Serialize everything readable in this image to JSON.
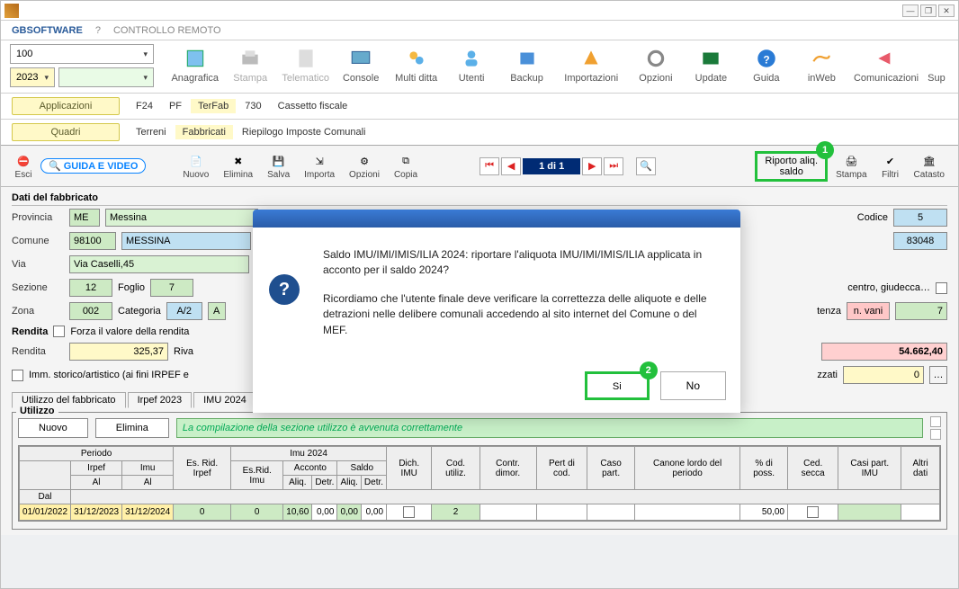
{
  "window": {
    "minimize": "—",
    "restore": "❐",
    "close": "✕"
  },
  "menu": {
    "main": "GBSOFTWARE",
    "help": "?",
    "remote": "CONTROLLO REMOTO"
  },
  "combos": {
    "num": "100",
    "year": "2023"
  },
  "ribbon": {
    "anagrafica": "Anagrafica",
    "stampa": "Stampa",
    "telematico": "Telematico",
    "console": "Console",
    "multiditta": "Multi ditta",
    "utenti": "Utenti",
    "backup": "Backup",
    "importazioni": "Importazioni",
    "opzioni": "Opzioni",
    "update": "Update",
    "guida": "Guida",
    "inweb": "inWeb",
    "comunicazioni": "Comunicazioni",
    "sup": "Sup"
  },
  "subnav": {
    "applicazioni": "Applicazioni",
    "quadri": "Quadri",
    "tabs1": [
      "F24",
      "PF",
      "TerFab",
      "730",
      "Cassetto fiscale"
    ],
    "tabs2": [
      "Terreni",
      "Fabbricati",
      "Riepilogo Imposte Comunali"
    ],
    "tabs1_active": 2,
    "tabs2_active": 1
  },
  "toolbar": {
    "esci": "Esci",
    "guida_video": "GUIDA E VIDEO",
    "nuovo": "Nuovo",
    "elimina": "Elimina",
    "salva": "Salva",
    "importa": "Importa",
    "opzioni": "Opzioni",
    "copia": "Copia",
    "pager": "1 di 1",
    "riporto_line1": "Riporto aliq.",
    "riporto_line2": "saldo",
    "stampa": "Stampa",
    "filtri": "Filtri",
    "catasto": "Catasto"
  },
  "markers": {
    "one": "1",
    "two": "2"
  },
  "form": {
    "title": "Dati del fabbricato",
    "provincia_lbl": "Provincia",
    "provincia_code": "ME",
    "provincia_name": "Messina",
    "codice_lbl": "Codice",
    "codice_val": "5",
    "comune_lbl": "Comune",
    "comune_cap": "98100",
    "comune_name": "MESSINA",
    "comune_code": "83048",
    "via_lbl": "Via",
    "via_val": "Via Caselli,45",
    "sezione_lbl": "Sezione",
    "sezione_val": "12",
    "foglio_lbl": "Foglio",
    "foglio_val": "7",
    "centro_lbl": "centro, giudecca…",
    "zona_lbl": "Zona",
    "zona_val": "002",
    "categoria_lbl": "Categoria",
    "categoria_val": "A/2",
    "categoria_code": "A",
    "tenza_lbl": "tenza",
    "nvani_lbl": "n. vani",
    "nvani_val": "7",
    "rendita_group": "Rendita",
    "forza_lbl": "Forza il valore della rendita",
    "rendita_lbl": "Rendita",
    "rendita_val": "325,37",
    "riva_lbl": "Riva",
    "tot_val": "54.662,40",
    "storico_lbl": "Imm. storico/artistico (ai fini IRPEF e",
    "zzati_lbl": "zzati",
    "zzati_val": "0",
    "tabs": [
      "Utilizzo del fabbricato",
      "Irpef 2023",
      "IMU 2024"
    ]
  },
  "utilizzo": {
    "title": "Utilizzo",
    "nuovo": "Nuovo",
    "elimina": "Elimina",
    "msg": "La compilazione della sezione utilizzo è avvenuta correttamente",
    "headers": {
      "periodo": "Periodo",
      "irpef": "Irpef",
      "imu": "Imu",
      "dal": "Dal",
      "al": "Al",
      "esrid": "Es. Rid. Irpef",
      "imu2024": "Imu 2024",
      "esrid_imu": "Es.Rid. Imu",
      "acconto": "Acconto",
      "saldo": "Saldo",
      "aliq": "Aliq.",
      "detr": "Detr.",
      "dich": "Dich. IMU",
      "cod_util": "Cod. utiliz.",
      "contr": "Contr. dimor.",
      "pert": "Pert di cod.",
      "caso": "Caso part.",
      "canone": "Canone lordo del periodo",
      "poss": "% di poss.",
      "ced": "Ced. secca",
      "casi": "Casi part. IMU",
      "altri": "Altri dati"
    },
    "row": {
      "dal": "01/01/2022",
      "al_irpef": "31/12/2023",
      "al_imu": "31/12/2024",
      "esrid": "0",
      "esrid_imu": "0",
      "acc_aliq": "10,60",
      "acc_detr": "0,00",
      "sal_aliq": "0,00",
      "sal_detr": "0,00",
      "cod_util": "2",
      "poss": "50,00"
    }
  },
  "modal": {
    "p1": "Saldo IMU/IMI/IMIS/ILIA 2024: riportare l'aliquota IMU/IMI/IMIS/ILIA applicata in acconto per il saldo 2024?",
    "p2": "Ricordiamo che l'utente finale deve verificare la correttezza delle aliquote e delle detrazioni nelle delibere comunali accedendo al sito internet del Comune o del MEF.",
    "si": "Si",
    "no": "No"
  }
}
